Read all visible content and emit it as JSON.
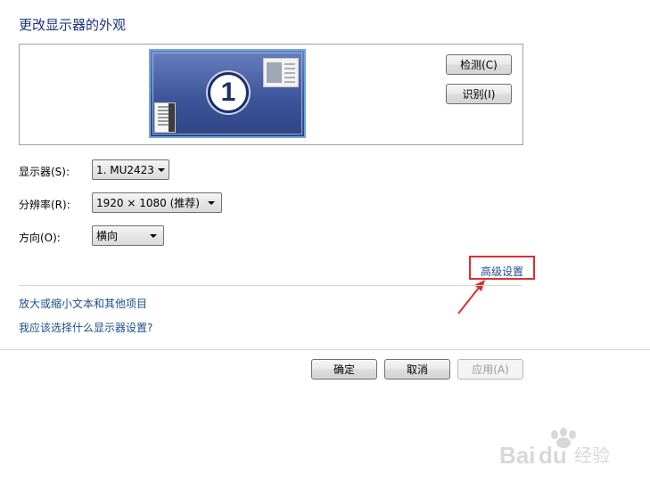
{
  "page": {
    "title": "更改显示器的外观"
  },
  "preview": {
    "monitor_number": "1"
  },
  "buttons": {
    "detect": "检测(C)",
    "identify": "识别(I)",
    "ok": "确定",
    "cancel": "取消",
    "apply": "应用(A)"
  },
  "settings": {
    "display": {
      "label": "显示器(S):",
      "value": "1. MU2423"
    },
    "resolution": {
      "label": "分辨率(R):",
      "value": "1920 × 1080 (推荐)"
    },
    "orientation": {
      "label": "方向(O):",
      "value": "横向"
    }
  },
  "links": {
    "advanced": "高级设置",
    "text_size": "放大或缩小文本和其他项目",
    "which_settings": "我应该选择什么显示器设置?"
  },
  "colors": {
    "title": "#1e3287",
    "link": "#1b4f8c",
    "annotation": "#d83030"
  },
  "watermark": {
    "text": "Baidu经验"
  }
}
